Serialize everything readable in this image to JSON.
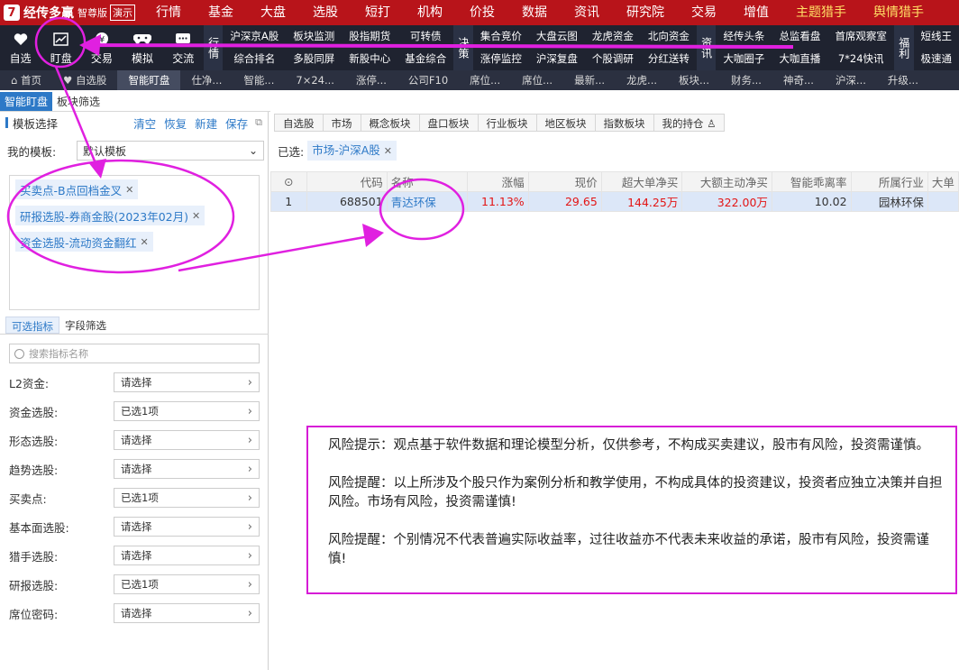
{
  "app": {
    "logo_text": "经传多赢",
    "edition": "智尊版",
    "demo": "演示"
  },
  "topmenu": [
    "行情",
    "基金",
    "大盘",
    "选股",
    "短打",
    "机构",
    "价投",
    "数据",
    "资讯",
    "研究院",
    "交易",
    "增值",
    "主题猎手",
    "舆情猎手"
  ],
  "toolbar": {
    "buttons": [
      {
        "label": "自选",
        "icon": "heart-icon"
      },
      {
        "label": "盯盘",
        "icon": "monitor-chart-icon"
      },
      {
        "label": "交易",
        "icon": "trade-icon"
      },
      {
        "label": "模拟",
        "icon": "gamepad-icon"
      },
      {
        "label": "交流",
        "icon": "chat-icon"
      }
    ],
    "group1_label": "行情",
    "group1": [
      "沪深京A股",
      "综合排名",
      "板块监测",
      "多股同屏",
      "股指期货",
      "新股中心",
      "可转债",
      "基金综合"
    ],
    "group2_label": "决策",
    "group2": [
      "集合竞价",
      "涨停监控",
      "大盘云图",
      "沪深复盘",
      "龙虎资金",
      "个股调研",
      "北向资金",
      "分红送转"
    ],
    "group3_label": "资讯",
    "group3": [
      "经传头条",
      "大咖圈子",
      "总监看盘",
      "大咖直播",
      "首席观察室",
      "7*24快讯"
    ],
    "group4_label": "福利",
    "group4": [
      "短线王",
      "极速通"
    ]
  },
  "tabrow": [
    "首页",
    "自选股",
    "智能盯盘",
    "仕净...",
    "智能...",
    "7×24...",
    "涨停...",
    "公司F10",
    "席位...",
    "席位...",
    "最新...",
    "龙虎...",
    "板块...",
    "财务...",
    "神奇...",
    "沪深...",
    "升级..."
  ],
  "subtabs": [
    "智能盯盘",
    "板块筛选"
  ],
  "left": {
    "title": "模板选择",
    "actions": [
      "清空",
      "恢复",
      "新建",
      "保存"
    ],
    "my_template_label": "我的模板:",
    "my_template_value": "默认模板",
    "chips": [
      "买卖点-B点回档金叉",
      "研报选股-券商金股(2023年02月)",
      "资金选股-流动资金翻红"
    ],
    "filter_tabs": [
      "可选指标",
      "字段筛选"
    ],
    "search_placeholder": "搜索指标名称",
    "filters": [
      {
        "label": "L2资金:",
        "value": "请选择"
      },
      {
        "label": "资金选股:",
        "value": "已选1项"
      },
      {
        "label": "形态选股:",
        "value": "请选择"
      },
      {
        "label": "趋势选股:",
        "value": "请选择"
      },
      {
        "label": "买卖点:",
        "value": "已选1项"
      },
      {
        "label": "基本面选股:",
        "value": "请选择"
      },
      {
        "label": "猎手选股:",
        "value": "请选择"
      },
      {
        "label": "研报选股:",
        "value": "已选1项"
      },
      {
        "label": "席位密码:",
        "value": "请选择"
      }
    ]
  },
  "right": {
    "tabs": [
      "自选股",
      "市场",
      "概念板块",
      "盘口板块",
      "行业板块",
      "地区板块",
      "指数板块",
      "我的持仓"
    ],
    "selected_label": "已选:",
    "selected_chip": "市场-沪深A股",
    "table": {
      "headers": [
        "代码",
        "名称",
        "涨幅",
        "现价",
        "超大单净买",
        "大额主动净买",
        "智能乖离率",
        "所属行业",
        "大单"
      ],
      "rows": [
        {
          "idx": "1",
          "code": "688501",
          "name": "青达环保",
          "change": "11.13%",
          "price": "29.65",
          "super_net": "144.25万",
          "large_net": "322.00万",
          "bias": "10.02",
          "industry": "园林环保"
        }
      ]
    }
  },
  "risk": [
    "风险提示：观点基于软件数据和理论模型分析，仅供参考，不构成买卖建议，股市有风险，投资需谨慎。",
    "风险提醒：以上所涉及个股只作为案例分析和教学使用，不构成具体的投资建议，投资者应独立决策并自担风险。市场有风险，投资需谨慎!",
    "风险提醒：个别情况不代表普遍实际收益率，过往收益亦不代表未来收益的承诺，股市有风险，投资需谨慎!"
  ],
  "colors": {
    "brand_red": "#b8141a",
    "toolbar_bg": "#1f2330",
    "accent_blue": "#2d79c7",
    "annotation_magenta": "#e020e0",
    "up_red": "#e31515"
  }
}
